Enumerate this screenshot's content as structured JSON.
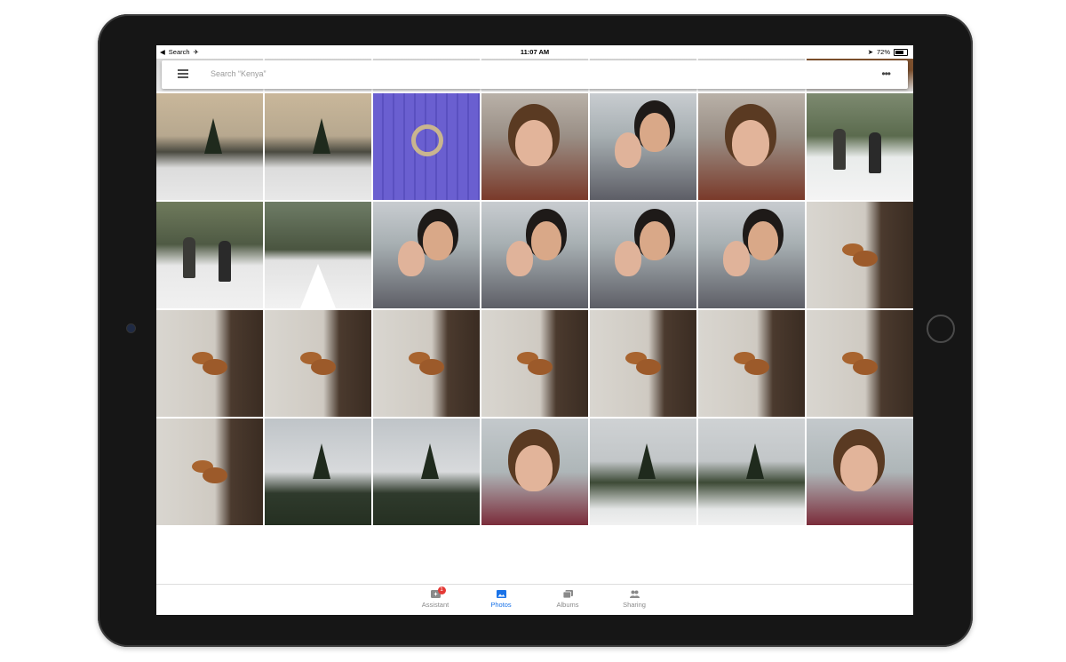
{
  "statusbar": {
    "back_app": "Search",
    "time": "11:07 AM",
    "battery": "72%"
  },
  "search": {
    "placeholder": "Search “Kenya”"
  },
  "grid": {
    "rows": [
      [
        "lake-winter",
        "lake-winter",
        "lake-winter",
        "lake-winter",
        "lake-winter",
        "lake-winter",
        "log-house"
      ],
      [
        "lake-winter",
        "lake-winter",
        "blue-door-wreath",
        "woman-selfie",
        "couple-selfie",
        "woman-selfie",
        "people-field"
      ],
      [
        "people-snow",
        "snow-bridge",
        "couple-selfie",
        "couple-selfie",
        "couple-selfie",
        "couple-selfie",
        "squirrel"
      ],
      [
        "squirrel",
        "squirrel",
        "squirrel",
        "squirrel",
        "squirrel",
        "squirrel",
        "squirrel"
      ],
      [
        "squirrel",
        "trees-sky",
        "trees-sky",
        "woman-portrait",
        "forest-snow",
        "forest-snow",
        "woman-portrait"
      ]
    ]
  },
  "nav": {
    "items": [
      {
        "label": "Assistant",
        "icon": "assistant-icon",
        "badge": "1"
      },
      {
        "label": "Photos",
        "icon": "photos-icon"
      },
      {
        "label": "Albums",
        "icon": "albums-icon"
      },
      {
        "label": "Sharing",
        "icon": "sharing-icon"
      }
    ]
  },
  "colors": {
    "accent": "#1a73e8",
    "badge": "#e53935"
  }
}
